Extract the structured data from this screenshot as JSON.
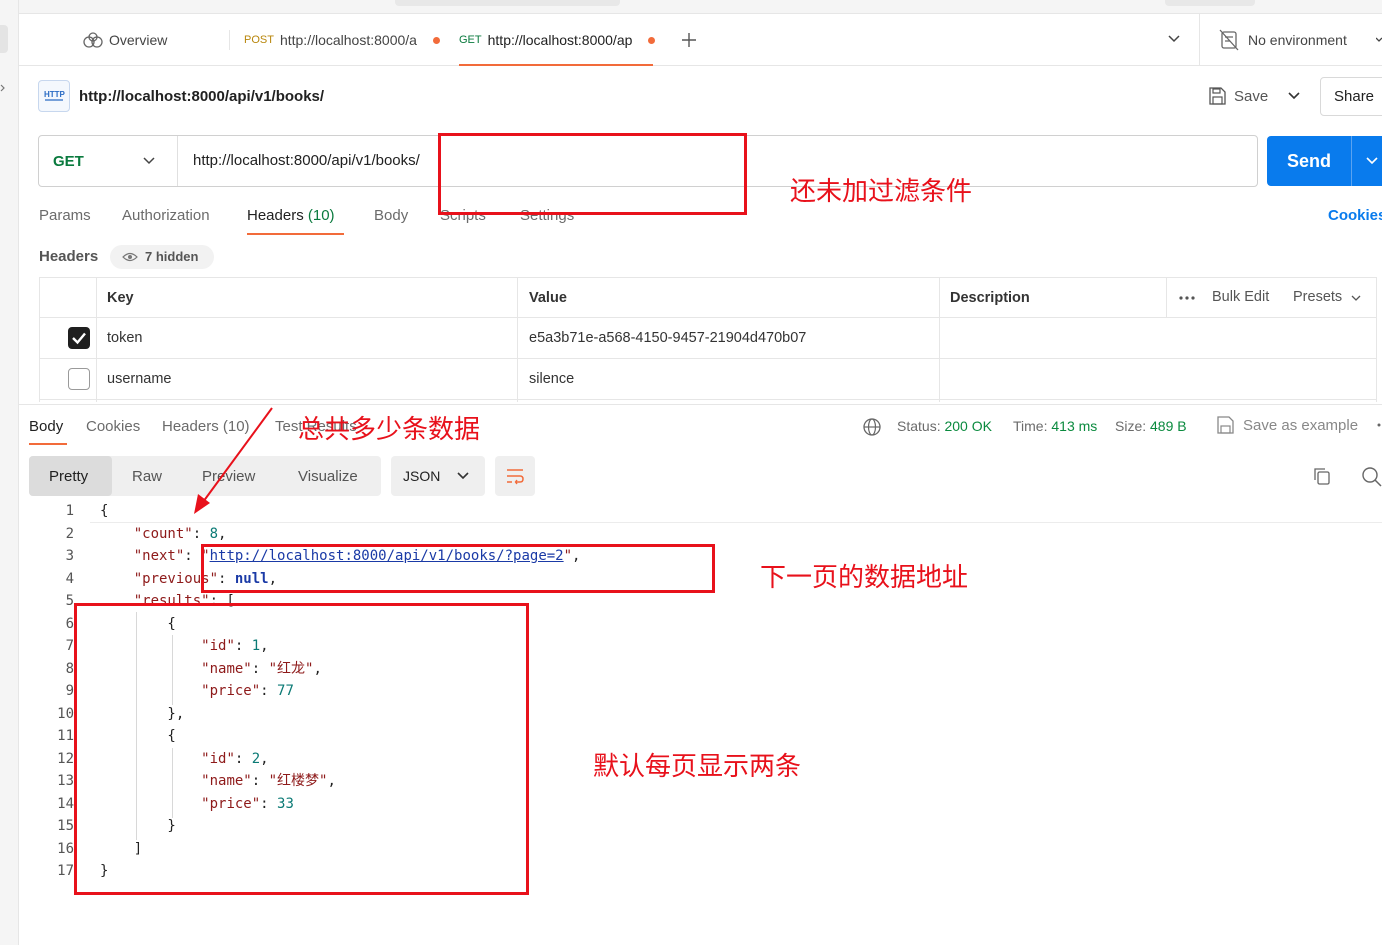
{
  "tabs": {
    "overview_label": "Overview",
    "tab1": {
      "method": "POST",
      "url": "http://localhost:8000/a"
    },
    "tab2": {
      "method": "GET",
      "url": "http://localhost:8000/ap"
    },
    "environment": "No environment"
  },
  "request": {
    "title": "http://localhost:8000/api/v1/books/",
    "save_label": "Save",
    "share_label": "Share",
    "method": "GET",
    "url": "http://localhost:8000/api/v1/books/",
    "send_label": "Send",
    "cookies_label": "Cookies"
  },
  "request_tabs": {
    "params": "Params",
    "authorization": "Authorization",
    "headers": "Headers",
    "headers_count": "(10)",
    "body": "Body",
    "scripts": "Scripts",
    "settings": "Settings"
  },
  "headers_section": {
    "label": "Headers",
    "hidden": "7 hidden",
    "columns": {
      "key": "Key",
      "value": "Value",
      "description": "Description"
    },
    "bulk_edit": "Bulk Edit",
    "presets": "Presets",
    "rows": [
      {
        "checked": true,
        "key": "token",
        "value": "e5a3b71e-a568-4150-9457-21904d470b07"
      },
      {
        "checked": false,
        "key": "username",
        "value": "silence"
      }
    ]
  },
  "response": {
    "tabs": {
      "body": "Body",
      "cookies": "Cookies",
      "headers": "Headers (10)",
      "tests": "Test Results"
    },
    "status_label": "Status:",
    "status_value": "200 OK",
    "time_label": "Time:",
    "time_value": "413 ms",
    "size_label": "Size:",
    "size_value": "489 B",
    "save_example": "Save as example",
    "views": {
      "pretty": "Pretty",
      "raw": "Raw",
      "preview": "Preview",
      "visualize": "Visualize"
    },
    "format": "JSON",
    "lines": [
      [
        {
          "t": "{",
          "c": ""
        }
      ],
      [
        {
          "t": "    ",
          "c": ""
        },
        {
          "t": "\"count\"",
          "c": "key"
        },
        {
          "t": ": ",
          "c": ""
        },
        {
          "t": "8",
          "c": "num"
        },
        {
          "t": ",",
          "c": ""
        }
      ],
      [
        {
          "t": "    ",
          "c": ""
        },
        {
          "t": "\"next\"",
          "c": "key"
        },
        {
          "t": ": ",
          "c": ""
        },
        {
          "t": "\"",
          "c": "link-q"
        },
        {
          "t": "http://localhost:8000/api/v1/books/?page=2",
          "c": "link"
        },
        {
          "t": "\"",
          "c": "link-q"
        },
        {
          "t": ",",
          "c": ""
        }
      ],
      [
        {
          "t": "    ",
          "c": ""
        },
        {
          "t": "\"previous\"",
          "c": "key"
        },
        {
          "t": ": ",
          "c": ""
        },
        {
          "t": "null",
          "c": "kw"
        },
        {
          "t": ",",
          "c": ""
        }
      ],
      [
        {
          "t": "    ",
          "c": ""
        },
        {
          "t": "\"results\"",
          "c": "key"
        },
        {
          "t": ": [",
          "c": ""
        }
      ],
      [
        {
          "t": "        {",
          "c": ""
        }
      ],
      [
        {
          "t": "            ",
          "c": ""
        },
        {
          "t": "\"id\"",
          "c": "key"
        },
        {
          "t": ": ",
          "c": ""
        },
        {
          "t": "1",
          "c": "num"
        },
        {
          "t": ",",
          "c": ""
        }
      ],
      [
        {
          "t": "            ",
          "c": ""
        },
        {
          "t": "\"name\"",
          "c": "key"
        },
        {
          "t": ": ",
          "c": ""
        },
        {
          "t": "\"红龙\"",
          "c": "key"
        },
        {
          "t": ",",
          "c": ""
        }
      ],
      [
        {
          "t": "            ",
          "c": ""
        },
        {
          "t": "\"price\"",
          "c": "key"
        },
        {
          "t": ": ",
          "c": ""
        },
        {
          "t": "77",
          "c": "num"
        }
      ],
      [
        {
          "t": "        },",
          "c": ""
        }
      ],
      [
        {
          "t": "        {",
          "c": ""
        }
      ],
      [
        {
          "t": "            ",
          "c": ""
        },
        {
          "t": "\"id\"",
          "c": "key"
        },
        {
          "t": ": ",
          "c": ""
        },
        {
          "t": "2",
          "c": "num"
        },
        {
          "t": ",",
          "c": ""
        }
      ],
      [
        {
          "t": "            ",
          "c": ""
        },
        {
          "t": "\"name\"",
          "c": "key"
        },
        {
          "t": ": ",
          "c": ""
        },
        {
          "t": "\"红楼梦\"",
          "c": "key"
        },
        {
          "t": ",",
          "c": ""
        }
      ],
      [
        {
          "t": "            ",
          "c": ""
        },
        {
          "t": "\"price\"",
          "c": "key"
        },
        {
          "t": ": ",
          "c": ""
        },
        {
          "t": "33",
          "c": "num"
        }
      ],
      [
        {
          "t": "        }",
          "c": ""
        }
      ],
      [
        {
          "t": "    ]",
          "c": ""
        }
      ],
      [
        {
          "t": "}",
          "c": ""
        }
      ]
    ]
  },
  "annotations": {
    "no_filter": "还未加过滤条件",
    "total_count": "总共多少条数据",
    "next_page": "下一页的数据地址",
    "default_page_size": "默认每页显示两条"
  },
  "colors": {
    "accent": "#f26b3a",
    "send": "#097bed",
    "annotation": "#e8111b",
    "status_ok": "#0a8a3e"
  }
}
